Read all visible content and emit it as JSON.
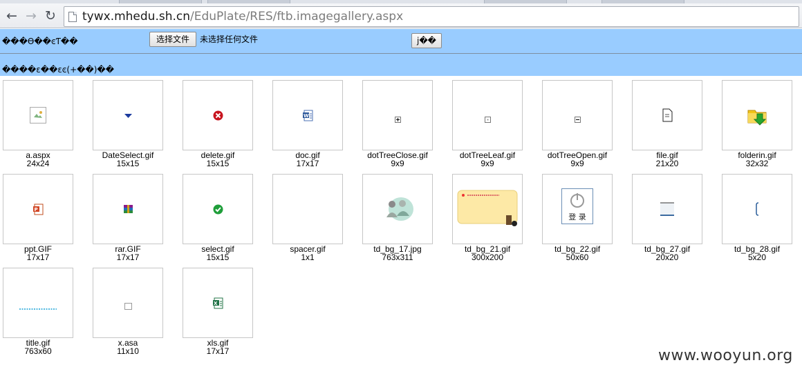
{
  "browser": {
    "back_label": "←",
    "forward_label": "→",
    "reload_label": "↻",
    "url_host": "tywx.mhedu.sh.cn",
    "url_path": "/EduPlate/RES/ftb.imagegallery.aspx"
  },
  "upload": {
    "label": "���ϴ��ͼƬ��",
    "choose_file_label": "选择文件",
    "no_file_label": "未选择任何文件",
    "submit_label": "j��",
    "list_label": "����ɛ��ɛͼ(+��)��"
  },
  "gallery": [
    {
      "name": "a.aspx",
      "size": "24x24",
      "icon": "broken-image-icon"
    },
    {
      "name": "DateSelect.gif",
      "size": "15x15",
      "icon": "dropdown-arrow-icon"
    },
    {
      "name": "delete.gif",
      "size": "15x15",
      "icon": "delete-icon"
    },
    {
      "name": "doc.gif",
      "size": "17x17",
      "icon": "word-doc-icon"
    },
    {
      "name": "dotTreeClose.gif",
      "size": "9x9",
      "icon": "tree-expand-icon"
    },
    {
      "name": "dotTreeLeaf.gif",
      "size": "9x9",
      "icon": "tree-leaf-icon"
    },
    {
      "name": "dotTreeOpen.gif",
      "size": "9x9",
      "icon": "tree-collapse-icon"
    },
    {
      "name": "file.gif",
      "size": "21x20",
      "icon": "file-icon"
    },
    {
      "name": "folderin.gif",
      "size": "32x32",
      "icon": "folder-in-icon"
    },
    {
      "name": "ppt.GIF",
      "size": "17x17",
      "icon": "ppt-icon"
    },
    {
      "name": "rar.GIF",
      "size": "17x17",
      "icon": "rar-icon"
    },
    {
      "name": "select.gif",
      "size": "15x15",
      "icon": "check-icon"
    },
    {
      "name": "spacer.gif",
      "size": "1x1",
      "icon": "spacer-icon"
    },
    {
      "name": "td_bg_17.jpg",
      "size": "763x311",
      "icon": "people-banner-icon"
    },
    {
      "name": "td_bg_21.gif",
      "size": "300x200",
      "icon": "login-note-image"
    },
    {
      "name": "td_bg_22.gif",
      "size": "50x60",
      "icon": "power-login-icon",
      "text": "登 录"
    },
    {
      "name": "td_bg_27.gif",
      "size": "20x20",
      "icon": "bar-bg-icon"
    },
    {
      "name": "td_bg_28.gif",
      "size": "5x20",
      "icon": "bracket-bg-icon"
    },
    {
      "name": "title.gif",
      "size": "763x60",
      "icon": "title-strip-icon"
    },
    {
      "name": "x.asa",
      "size": "11x10",
      "icon": "empty-box-icon"
    },
    {
      "name": "xls.gif",
      "size": "17x17",
      "icon": "excel-icon"
    }
  ],
  "watermark": "www.wooyun.org",
  "colors": {
    "bar": "#99ccff",
    "thumb_border": "#c6c6c6"
  }
}
